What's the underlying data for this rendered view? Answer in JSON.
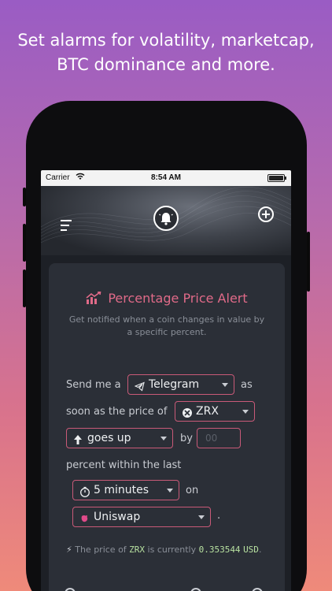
{
  "promo": {
    "headline_line1": "Set alarms for volatility, marketcap,",
    "headline_line2": "BTC dominance and more."
  },
  "status_bar": {
    "carrier": "Carrier",
    "time": "8:54 AM"
  },
  "header": {
    "menu_icon": "hamburger-icon",
    "center_icon": "bell-icon",
    "action_icon": "plus-circle-icon"
  },
  "alert": {
    "title": "Percentage Price Alert",
    "subtitle": "Get notified when a coin changes in value by a specific percent.",
    "sentence": {
      "send_me_a": "Send me a",
      "channel": "Telegram",
      "as": "as",
      "soon_as_price_of": "soon as the price of",
      "coin": "ZRX",
      "direction": "goes up",
      "by": "by",
      "percent_placeholder": "00",
      "percent_within": "percent within the last",
      "timeframe": "5 minutes",
      "on": "on",
      "exchange": "Uniswap",
      "period": "."
    },
    "info": {
      "prefix": "The price of",
      "coin": "ZRX",
      "middle": "is currently",
      "price": "0.353544",
      "currency": "USD",
      "suffix": "."
    }
  },
  "colors": {
    "accent": "#e06a88",
    "border": "#c95a78",
    "card": "#2b2f37",
    "price": "#b7e0a0"
  }
}
